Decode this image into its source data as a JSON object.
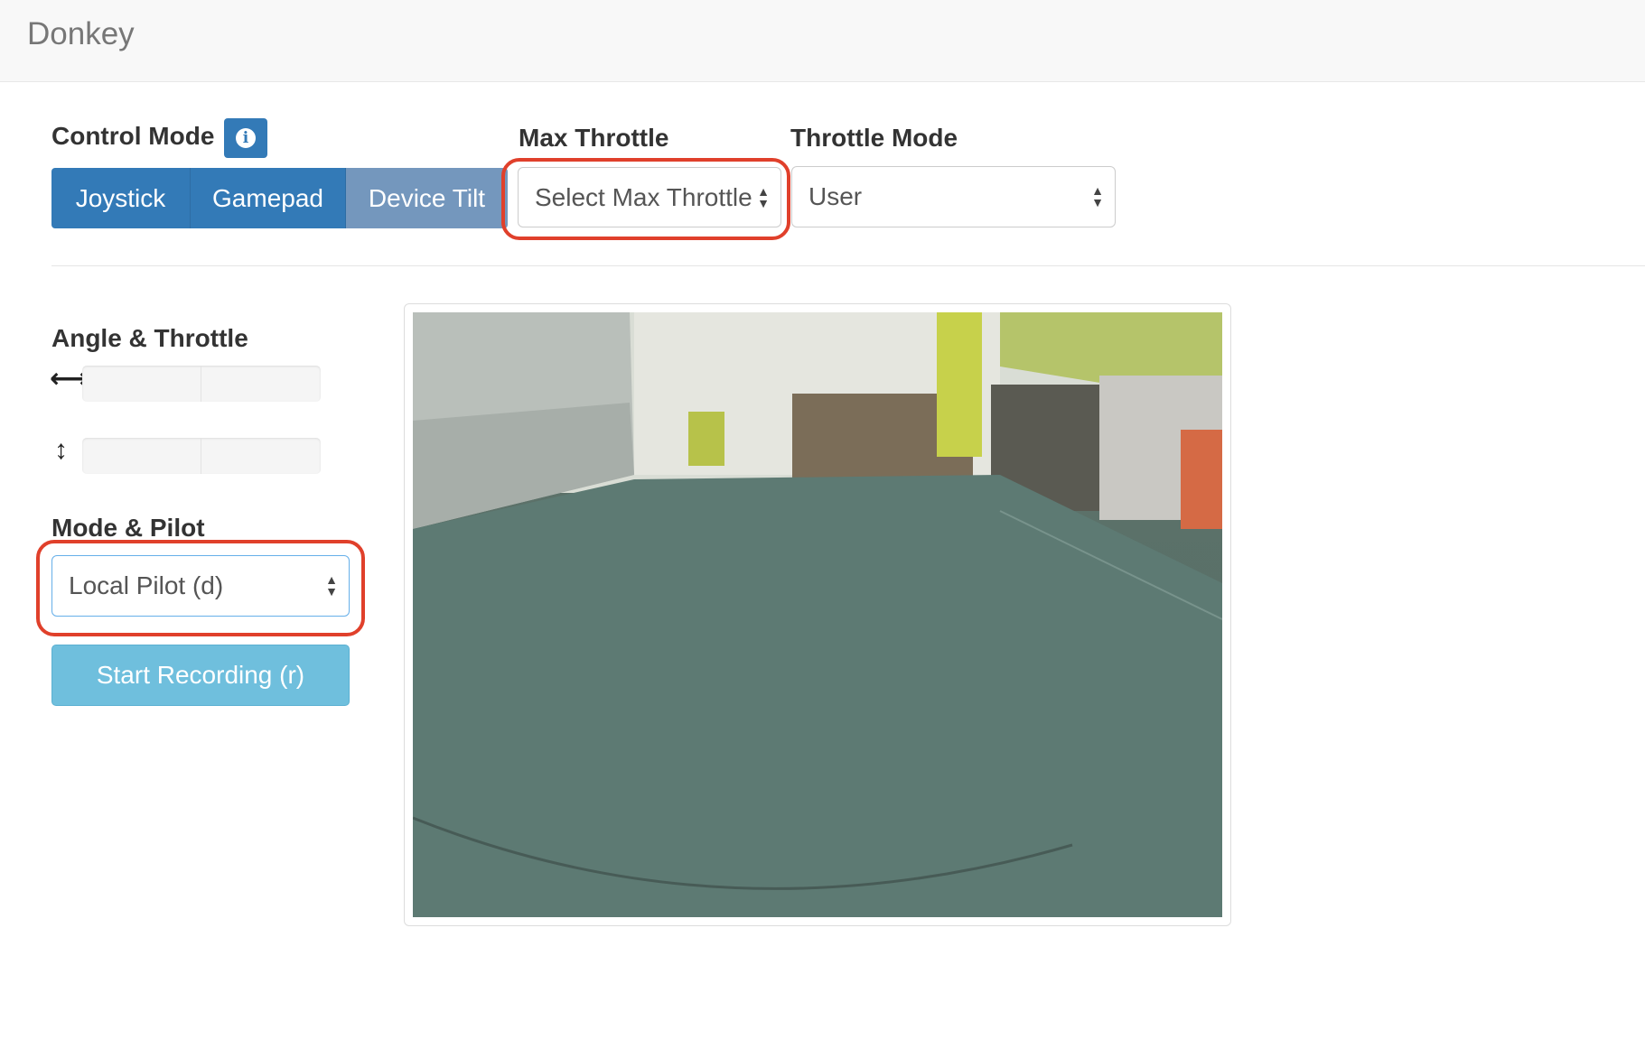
{
  "navbar": {
    "brand": "Donkey"
  },
  "controls": {
    "control_mode_label": "Control Mode",
    "info_icon": "info-icon",
    "modes": [
      "Joystick",
      "Gamepad",
      "Device Tilt"
    ],
    "max_throttle_label": "Max Throttle",
    "max_throttle_value": "Select Max Throttle",
    "throttle_mode_label": "Throttle Mode",
    "throttle_mode_value": "User"
  },
  "left_panel": {
    "angle_throttle_label": "Angle & Throttle",
    "mode_pilot_label": "Mode & Pilot",
    "mode_pilot_value": "Local Pilot (d)",
    "record_button": "Start Recording (r)"
  },
  "colors": {
    "primary": "#337ab7",
    "inactive_segment": "#7497bd",
    "record_button": "#6fbfdd",
    "highlight": "#e0402b"
  }
}
